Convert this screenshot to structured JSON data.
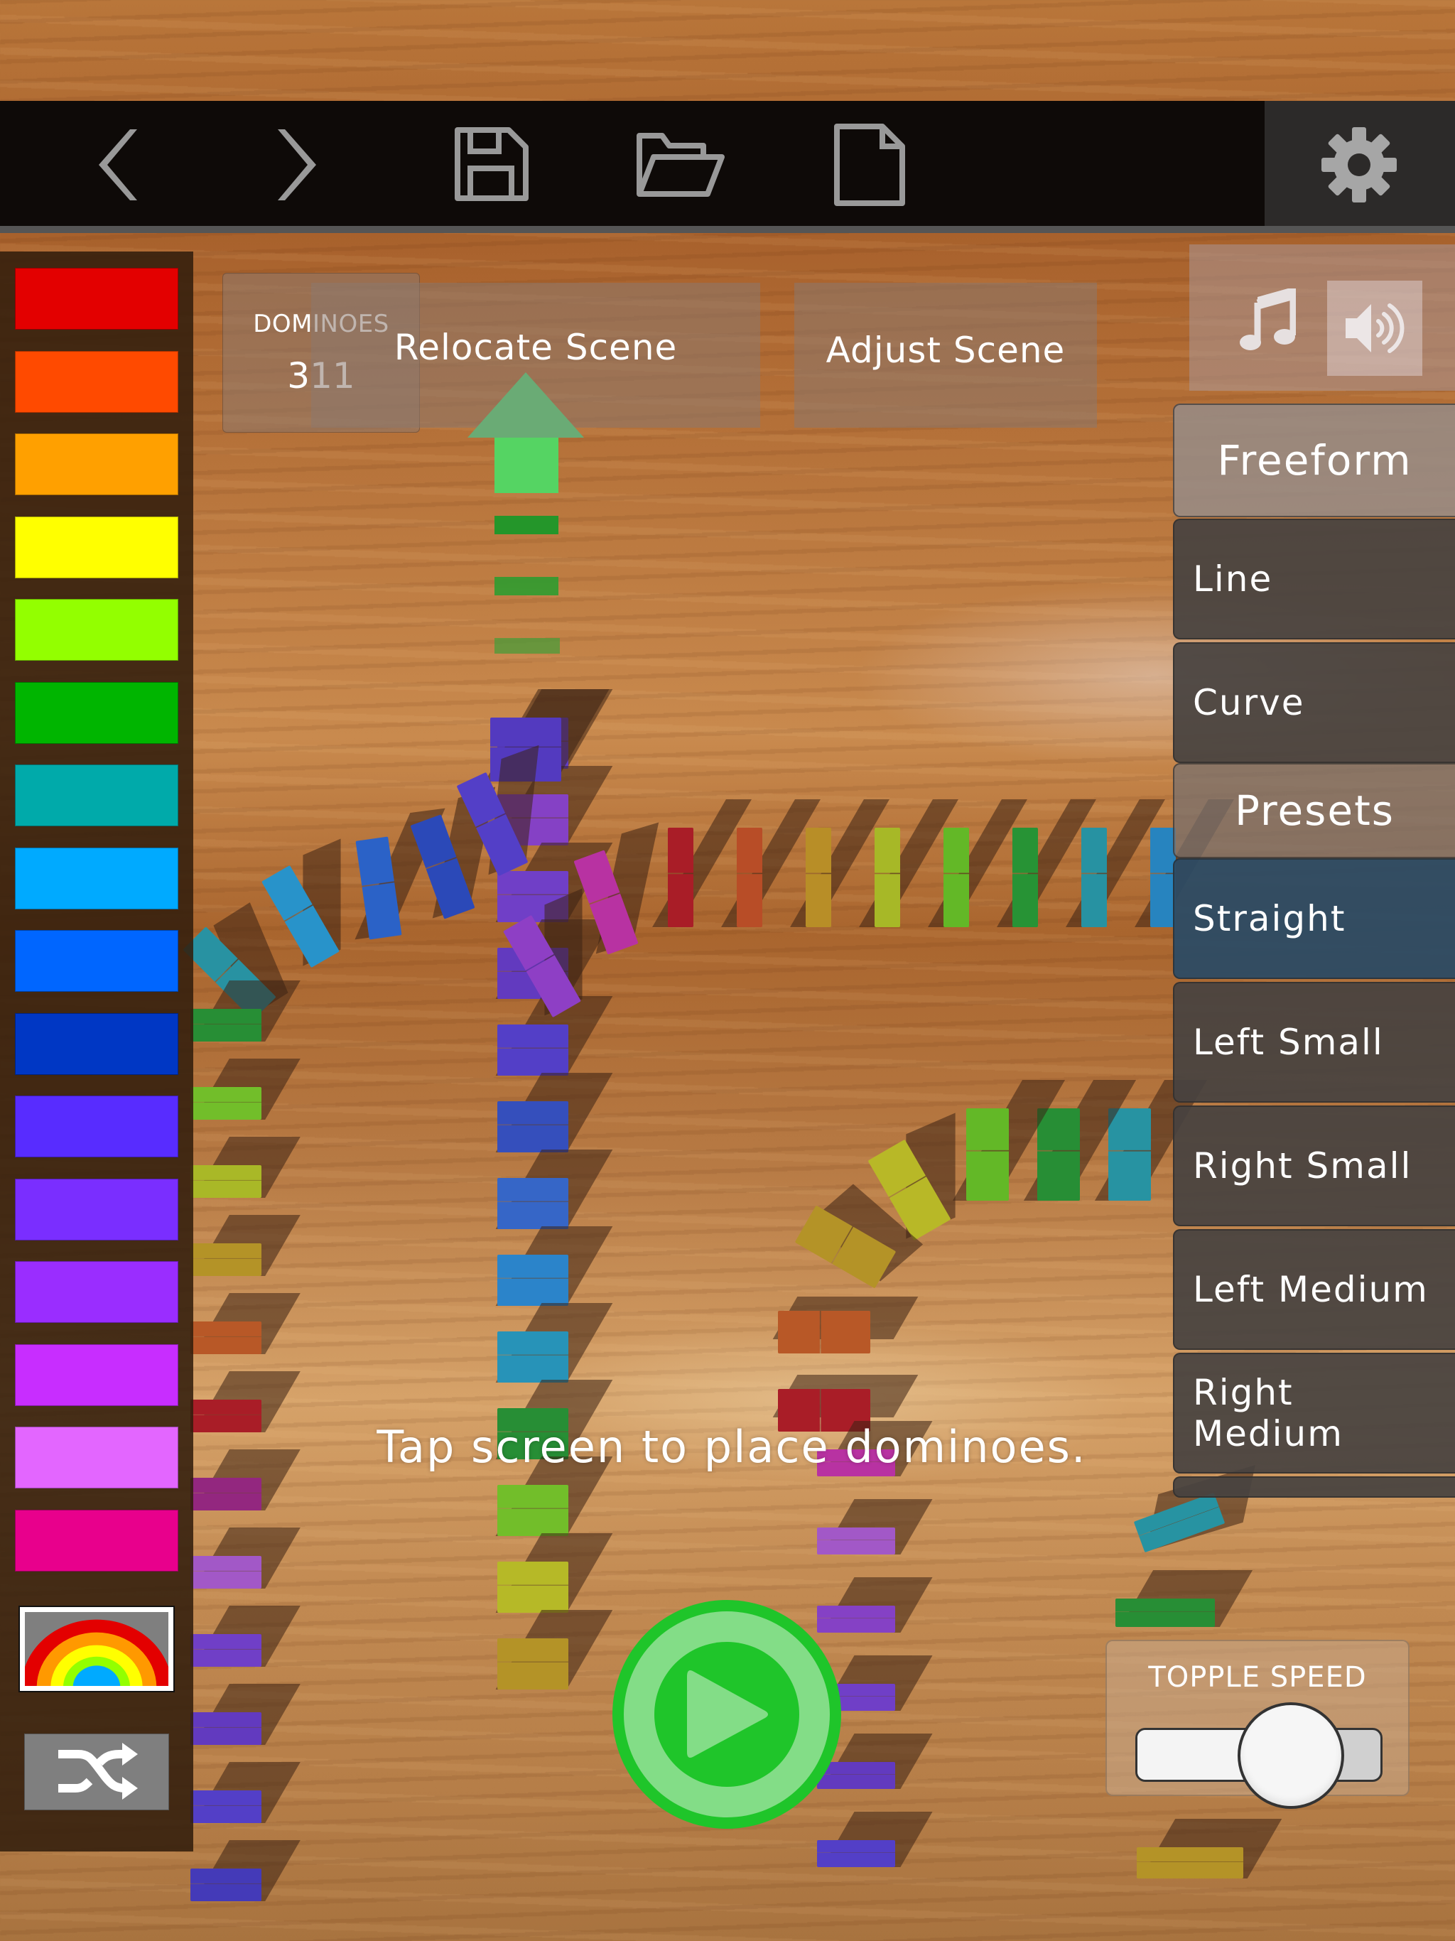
{
  "toolbar": {
    "buttons": [
      {
        "name": "undo",
        "icon": "chevron-left-icon"
      },
      {
        "name": "redo",
        "icon": "chevron-right-icon"
      },
      {
        "name": "save",
        "icon": "floppy-disk-icon"
      },
      {
        "name": "open",
        "icon": "folder-open-icon"
      },
      {
        "name": "new",
        "icon": "new-file-icon"
      },
      {
        "name": "settings",
        "icon": "gear-icon"
      }
    ]
  },
  "counter": {
    "label": "DOMINOES",
    "value": "311"
  },
  "actions": {
    "relocate_label": "Relocate Scene",
    "adjust_label": "Adjust Scene"
  },
  "audio": {
    "music_icon": "music-note-icon",
    "sound_icon": "speaker-volume-icon",
    "sound_active": true
  },
  "palette": {
    "colors": [
      "#e30000",
      "#ff4a00",
      "#ffa000",
      "#ffff00",
      "#93ff00",
      "#00b500",
      "#00aaaa",
      "#00aaff",
      "#0066ff",
      "#0037c4",
      "#582cff",
      "#7a2eff",
      "#9a2dff",
      "#c82dff",
      "#e366ff",
      "#e8008c"
    ],
    "rainbow_label": "rainbow-mode",
    "rainbow_colors": [
      "#e30000",
      "#ff9900",
      "#ffff00",
      "#93ff00",
      "#00aaff"
    ],
    "shuffle_icon": "shuffle-icon"
  },
  "modes": {
    "freeform_header": "Freeform",
    "freeform_items": [
      "Line",
      "Curve"
    ],
    "presets_header": "Presets",
    "preset_items": [
      "Straight",
      "Left Small",
      "Right Small",
      "Left Medium",
      "Right Medium"
    ],
    "selected": "Straight"
  },
  "hint": "Tap screen to place dominoes.",
  "play": {
    "icon": "play-icon"
  },
  "topple_speed": {
    "label": "TOPPLE SPEED",
    "value": 0.63
  }
}
